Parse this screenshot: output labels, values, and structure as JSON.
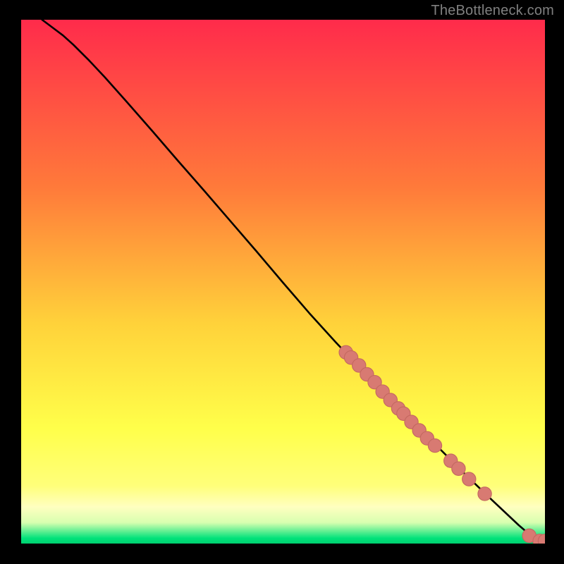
{
  "watermark": "TheBottleneck.com",
  "colors": {
    "bg_black": "#000000",
    "grad_top": "#ff2b4b",
    "grad_mid1": "#ff7a3a",
    "grad_mid2": "#ffd23a",
    "grad_mid3": "#ffff4a",
    "grad_pale": "#ffffc0",
    "grad_green": "#00e27a",
    "curve": "#000000",
    "point_fill": "#d87a72",
    "point_stroke": "#c46860"
  },
  "chart_data": {
    "type": "line",
    "title": "",
    "xlabel": "",
    "ylabel": "",
    "xlim": [
      0,
      100
    ],
    "ylim": [
      0,
      100
    ],
    "curve": [
      {
        "x": 4.0,
        "y": 100.0
      },
      {
        "x": 6.0,
        "y": 98.5
      },
      {
        "x": 8.0,
        "y": 97.0
      },
      {
        "x": 10.0,
        "y": 95.2
      },
      {
        "x": 13.0,
        "y": 92.2
      },
      {
        "x": 16.0,
        "y": 89.0
      },
      {
        "x": 20.0,
        "y": 84.5
      },
      {
        "x": 25.0,
        "y": 78.8
      },
      {
        "x": 30.0,
        "y": 73.0
      },
      {
        "x": 35.0,
        "y": 67.3
      },
      {
        "x": 40.0,
        "y": 61.5
      },
      {
        "x": 45.0,
        "y": 55.7
      },
      {
        "x": 50.0,
        "y": 49.8
      },
      {
        "x": 55.0,
        "y": 44.0
      },
      {
        "x": 60.0,
        "y": 38.5
      },
      {
        "x": 65.0,
        "y": 33.2
      },
      {
        "x": 70.0,
        "y": 28.0
      },
      {
        "x": 75.0,
        "y": 23.0
      },
      {
        "x": 80.0,
        "y": 18.0
      },
      {
        "x": 85.0,
        "y": 13.0
      },
      {
        "x": 90.0,
        "y": 8.2
      },
      {
        "x": 95.0,
        "y": 3.5
      },
      {
        "x": 98.5,
        "y": 0.5
      }
    ],
    "points": [
      {
        "x": 62.0,
        "y": 36.5
      },
      {
        "x": 63.0,
        "y": 35.5
      },
      {
        "x": 64.5,
        "y": 34.0
      },
      {
        "x": 66.0,
        "y": 32.3
      },
      {
        "x": 67.5,
        "y": 30.8
      },
      {
        "x": 69.0,
        "y": 29.0
      },
      {
        "x": 70.5,
        "y": 27.4
      },
      {
        "x": 72.0,
        "y": 25.8
      },
      {
        "x": 73.0,
        "y": 24.8
      },
      {
        "x": 74.5,
        "y": 23.2
      },
      {
        "x": 76.0,
        "y": 21.6
      },
      {
        "x": 77.5,
        "y": 20.1
      },
      {
        "x": 79.0,
        "y": 18.7
      },
      {
        "x": 82.0,
        "y": 15.8
      },
      {
        "x": 83.5,
        "y": 14.3
      },
      {
        "x": 85.5,
        "y": 12.3
      },
      {
        "x": 88.5,
        "y": 9.5
      },
      {
        "x": 97.0,
        "y": 1.5
      },
      {
        "x": 99.0,
        "y": 0.5
      },
      {
        "x": 100.0,
        "y": 0.5
      }
    ],
    "point_radius": 1.3
  }
}
